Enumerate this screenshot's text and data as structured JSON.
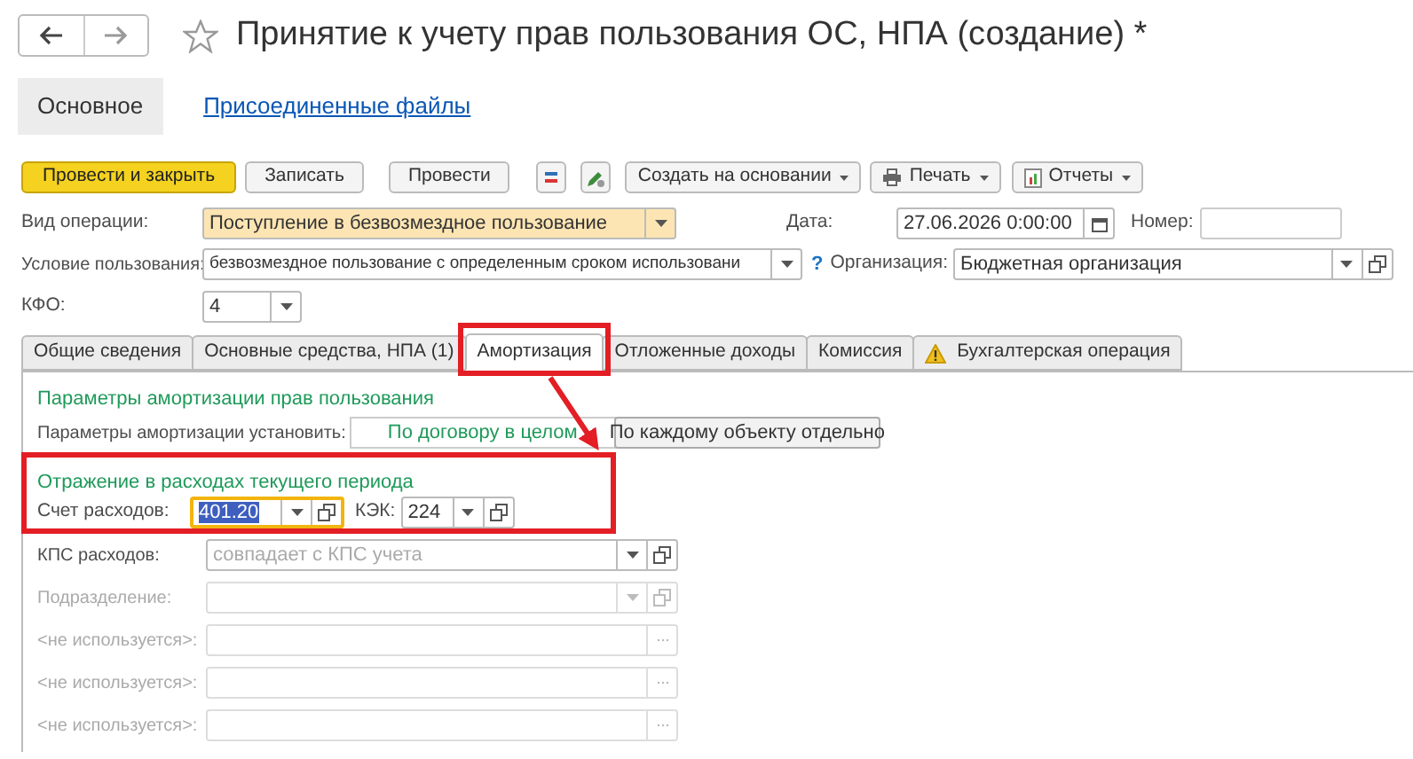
{
  "window": {
    "title": "Принятие к учету прав пользования ОС, НПА (создание) *",
    "favorite": false
  },
  "form_tabs": [
    {
      "label": "Основное",
      "selected": true
    },
    {
      "label": "Присоединенные файлы",
      "selected": false
    }
  ],
  "toolbar": [
    {
      "kind": "primary",
      "label": "Провести и закрыть"
    },
    {
      "kind": "plain",
      "label": "Записать"
    },
    {
      "kind": "plain",
      "label": "Провести"
    },
    {
      "kind": "journal-icon"
    },
    {
      "kind": "edit-icon"
    },
    {
      "kind": "menu",
      "label": "Создать на основании"
    },
    {
      "kind": "print-menu",
      "label": "Печать"
    },
    {
      "kind": "report-menu",
      "label": "Отчеты"
    }
  ],
  "operation": {
    "label": "Вид операции:",
    "value": "Поступление в безвозмездное пользование",
    "highlighted": true
  },
  "date": {
    "label": "Дата:",
    "value": "27.06.2026  0:00:00"
  },
  "number": {
    "label": "Номер:"
  },
  "condition": {
    "label": "Условие пользования:",
    "value": "безвозмездное пользование с определенным сроком использовани"
  },
  "help": "?",
  "organization": {
    "label": "Организация:",
    "value": "Бюджетная организация"
  },
  "kfo": {
    "label": "КФО:",
    "value": "4"
  },
  "tabs": [
    {
      "label": "Общие сведения",
      "selected": false,
      "warning": false
    },
    {
      "label": "Основные средства, НПА (1)",
      "selected": false,
      "warning": false
    },
    {
      "label": "Амортизация",
      "selected": true,
      "warning": false
    },
    {
      "label": "Отложенные доходы",
      "selected": false,
      "warning": false
    },
    {
      "label": "Комиссия",
      "selected": false,
      "warning": false
    },
    {
      "label": "Бухгалтерская операция",
      "selected": false,
      "warning": true
    }
  ],
  "amortization": {
    "title": "Параметры амортизации прав пользования",
    "label": "Параметры амортизации установить:",
    "options": [
      {
        "label": "По договору в целом",
        "selected": true
      },
      {
        "label": "По каждому объекту отдельно",
        "selected": false
      }
    ]
  },
  "expenses": {
    "title": "Отражение в расходах текущего периода",
    "account": {
      "label": "Счет расходов:",
      "value": "401.20",
      "focused": true
    },
    "kek": {
      "label": "КЭК:",
      "value": "224"
    }
  },
  "rows": [
    {
      "kind": "select",
      "label": "КПС расходов:",
      "placeholder": "совпадает с КПС учета",
      "disabled": false
    },
    {
      "kind": "select",
      "label": "Подразделение:",
      "disabled": true
    },
    {
      "kind": "choice",
      "label": "<не используется>:",
      "disabled": true
    },
    {
      "kind": "choice",
      "label": "<не используется>:",
      "disabled": true
    },
    {
      "kind": "choice",
      "label": "<не используется>:",
      "disabled": true
    }
  ]
}
